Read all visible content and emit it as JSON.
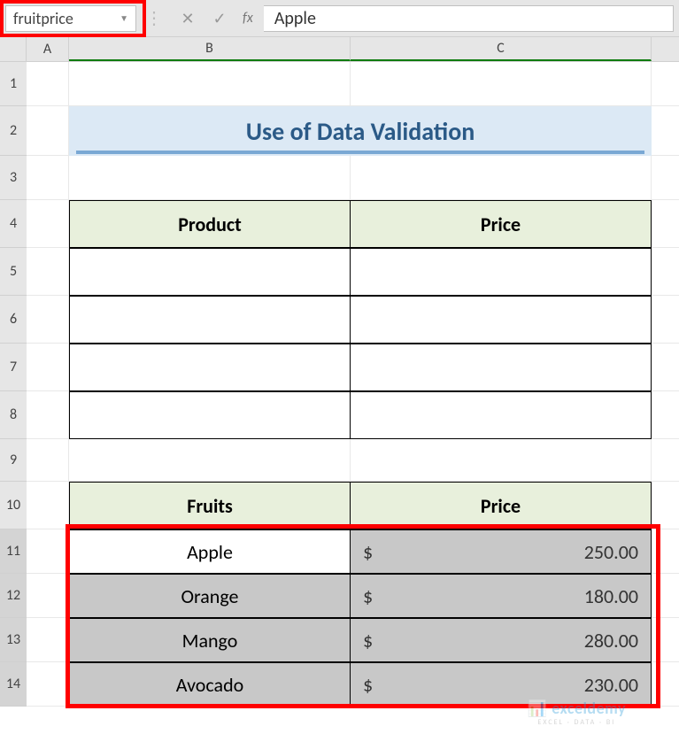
{
  "formula_bar": {
    "name_box": "fruitprice",
    "formula_value": "Apple"
  },
  "columns": {
    "a": "A",
    "b": "B",
    "c": "C"
  },
  "rows": [
    "1",
    "2",
    "3",
    "4",
    "5",
    "6",
    "7",
    "8",
    "9",
    "10",
    "11",
    "12",
    "13",
    "14"
  ],
  "title": "Use of Data Validation",
  "table1": {
    "headers": {
      "product": "Product",
      "price": "Price"
    },
    "rows": [
      {
        "product": "",
        "price": ""
      },
      {
        "product": "",
        "price": ""
      },
      {
        "product": "",
        "price": ""
      },
      {
        "product": "",
        "price": ""
      }
    ]
  },
  "table2": {
    "headers": {
      "fruits": "Fruits",
      "price": "Price"
    },
    "currency": "$",
    "rows": [
      {
        "fruit": "Apple",
        "price": "250.00"
      },
      {
        "fruit": "Orange",
        "price": "180.00"
      },
      {
        "fruit": "Mango",
        "price": "280.00"
      },
      {
        "fruit": "Avocado",
        "price": "230.00"
      }
    ]
  },
  "watermark": {
    "main": "exceldemy",
    "sub": "EXCEL · DATA · BI"
  }
}
